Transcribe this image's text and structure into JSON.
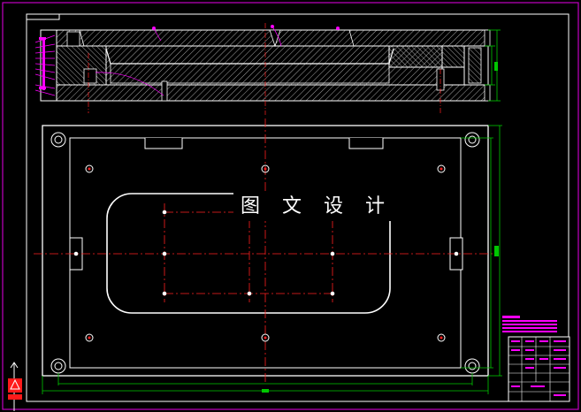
{
  "drawing": {
    "watermark_text": "图 文 设 计",
    "colors": {
      "background": "#000000",
      "frame": "#c000c0",
      "outline": "#ffffff",
      "hatch": "#b8b8b8",
      "centerline": "#ff2020",
      "dimension": "#00c800",
      "annotation": "#ff00ff",
      "ucs_red": "#ff1a1a"
    },
    "views": [
      "top-section-view",
      "plan-view"
    ],
    "title_block": {
      "visible": true
    }
  }
}
